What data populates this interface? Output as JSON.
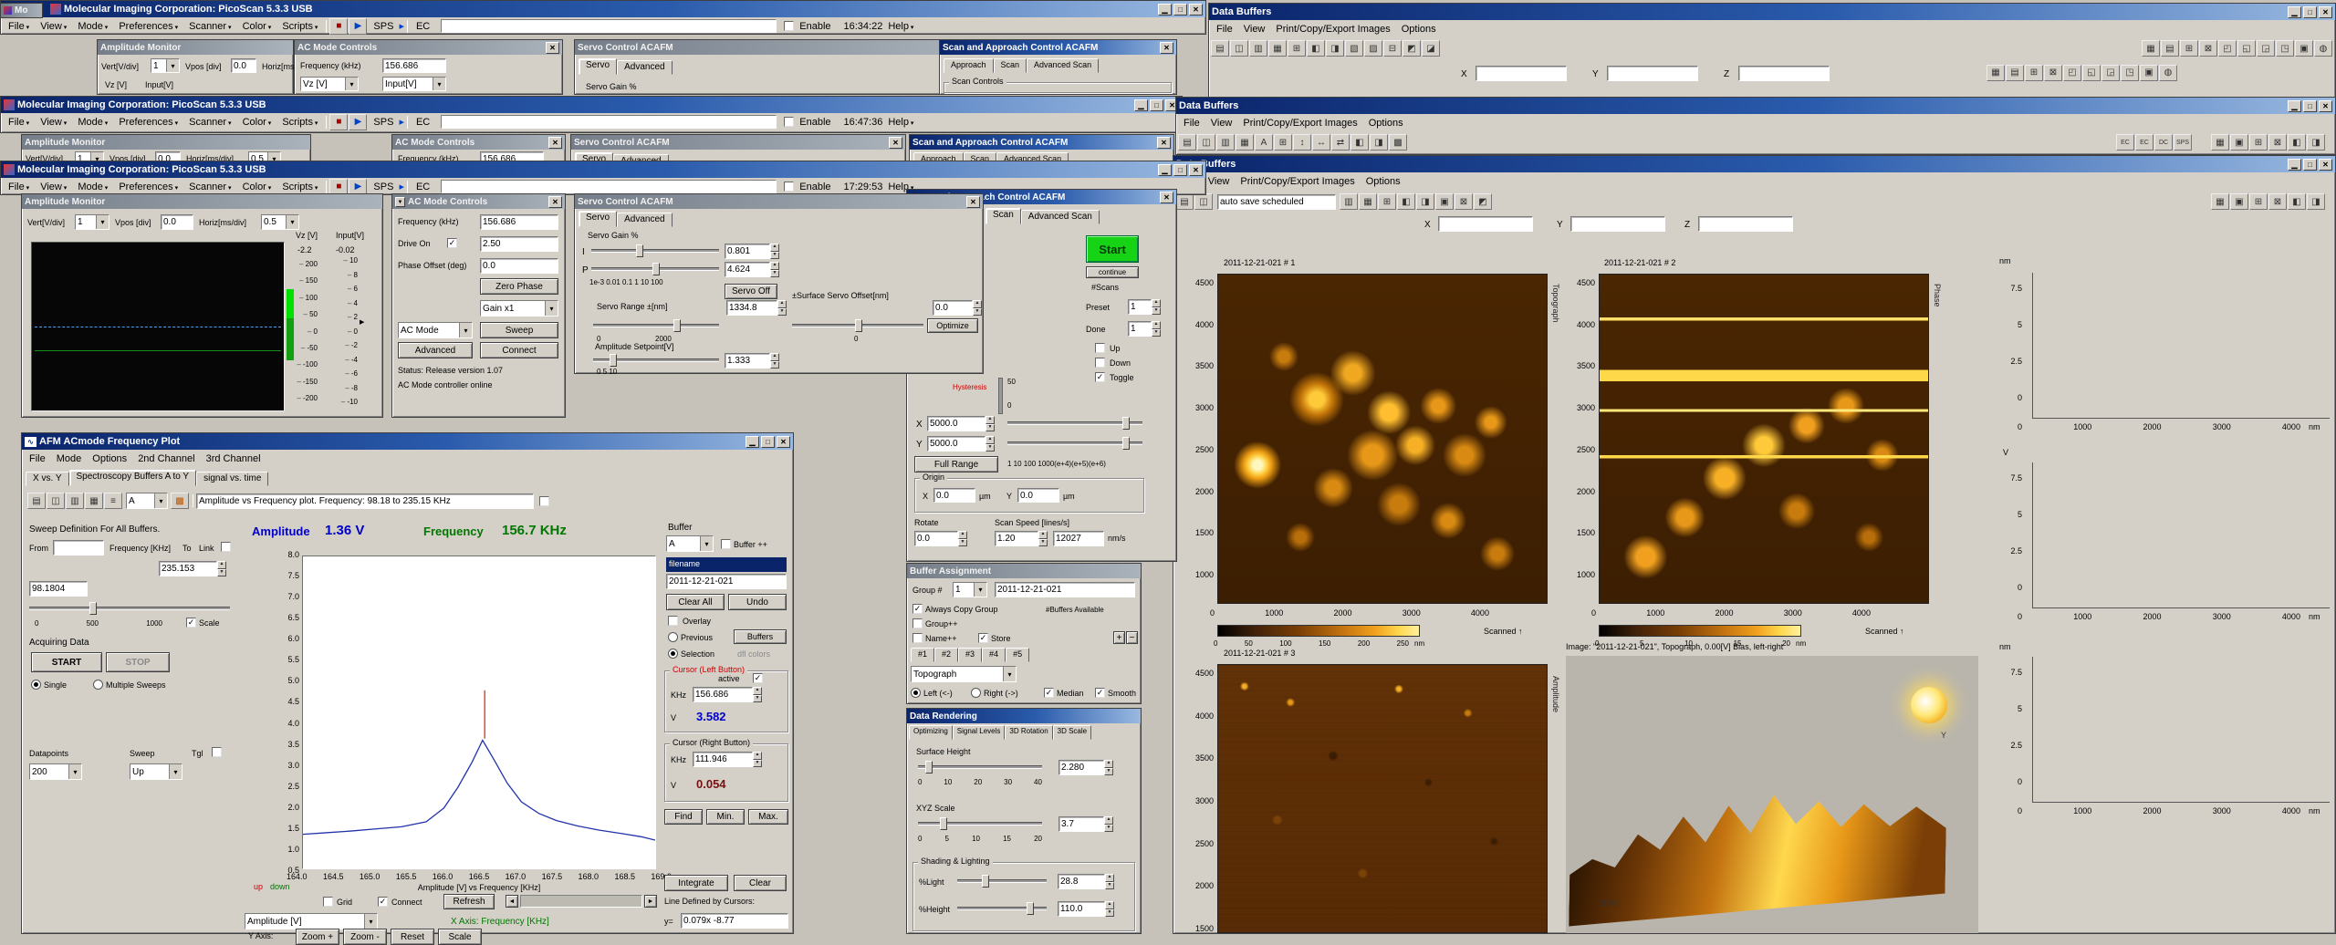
{
  "desktop": {
    "fragment_title": "Mo"
  },
  "pico": {
    "title": "Molecular Imaging Corporation: PicoScan 5.3.3  USB",
    "menu": [
      "File",
      "View",
      "Mode",
      "Preferences",
      "Scanner",
      "Color",
      "Scripts"
    ],
    "sps": "SPS",
    "ec": "EC",
    "enable_label": "Enable",
    "help": "Help",
    "times": {
      "w1": "16:34:22",
      "w2": "16:47:36",
      "w3": "17:29:53"
    }
  },
  "amp": {
    "title": "Amplitude  Monitor",
    "vert_label": "Vert[V/div]",
    "vert_value": "1",
    "vpos_label": "Vpos [div]",
    "vpos_value": "0.0",
    "horiz_label": "Horiz[ms/div]",
    "horiz_value": "0.5",
    "ch1": "Vz [V]",
    "ch1_value": "-2.2",
    "ch2": "Input[V]",
    "ch2_value": "-0.02",
    "scale_left": [
      "200",
      "150",
      "100",
      "50",
      "0",
      "-50",
      "-100",
      "-150",
      "-200"
    ],
    "scale_right": [
      "10",
      "8",
      "6",
      "4",
      "2",
      "0",
      "-2",
      "-4",
      "-6",
      "-8",
      "-10"
    ]
  },
  "acm": {
    "title": "AC Mode Controls",
    "frequency_label": "Frequency (kHz)",
    "frequency_value": "156.686",
    "drive_label": "Drive On",
    "drive_value": "2.50",
    "phase_label": "Phase Offset (deg)",
    "phase_value": "0.0",
    "zero_phase": "Zero Phase",
    "gain": "Gain x1",
    "mode": "AC Mode",
    "sweep": "Sweep",
    "advanced": "Advanced",
    "connect": "Connect",
    "status1": "Status:   Release version 1.07",
    "status2": "AC Mode controller online",
    "w1_ch1": "Vz [V]",
    "w1_ch2": "Input[V]"
  },
  "servo": {
    "title": "Servo Control ACAFM",
    "tab_servo": "Servo",
    "tab_advanced": "Advanced",
    "gain_group": "Servo Gain %",
    "i": "I",
    "p": "P",
    "i_value": "0.801",
    "p_value": "4.624",
    "log_scale": "1e-3  0.01    0.1      1       10     100",
    "servo_off": "Servo Off",
    "offset_label": "±Surface   Servo Offset[nm]",
    "offset_value": "0.0",
    "optimize": "Optimize",
    "offset_tick": "0",
    "range_label": "Servo Range ±[nm]",
    "range_value": "1334.8",
    "range_min": "0",
    "range_max": "2000",
    "setpoint_label": "Amplitude Setpoint[V]",
    "setpoint_value": "1.333",
    "setpoint_scale": "0            5             10"
  },
  "scan": {
    "title": "Scan and Approach Control ACAFM",
    "w1_tabs": [
      "Approach",
      "Scan",
      "Advanced Scan"
    ],
    "tab_scan": "Scan",
    "tab_adv": "Advanced Scan",
    "scan_controls": "Scan Controls",
    "start": "Start",
    "cont": "continue",
    "nscans": "#Scans",
    "preset": "Preset",
    "preset_value": "1",
    "done": "Done",
    "done_value": "1",
    "up": "Up",
    "down": "Down",
    "toggle": "Toggle",
    "hyst": "Hysteresis",
    "g50": "50",
    "g0": "0",
    "x": "X",
    "x_value": "5000.0",
    "y": "Y",
    "y_value": "5000.0",
    "full_range": "Full Range",
    "log_scale": "1     10    100   1000(e+4)(e+5)(e+6)",
    "origin": "Origin",
    "ox": "X",
    "ox_value": "0.0",
    "um": "µm",
    "oy": "Y",
    "oy_value": "0.0",
    "rotate": "Rotate",
    "rotate_value": "0.0",
    "speed_label": "Scan Speed [lines/s]",
    "speed": "1.20",
    "speed_nm": "12027",
    "nms": "nm/s"
  },
  "ba": {
    "title": "Buffer Assignment",
    "group": "Group #",
    "group_value": "1",
    "name": "2011-12-21-021",
    "always": "Always Copy Group",
    "avail": "#Buffers Available",
    "grouppp": "Group++",
    "namepp": "Name++",
    "store": "Store",
    "plus": "+",
    "minus": "−",
    "tabs": [
      "#1",
      "#2",
      "#3",
      "#4",
      "#5"
    ],
    "signal": "Topograph",
    "left": "Left (<-)",
    "right": "Right (->)",
    "median": "Median",
    "smooth": "Smooth"
  },
  "dr": {
    "title": "Data Rendering",
    "tabs": [
      "Optimizing",
      "Signal Levels",
      "3D Rotation",
      "3D Scale"
    ],
    "surface": "Surface Height",
    "surface_value": "2.280",
    "surface_ticks": [
      "0",
      "10",
      "20",
      "30",
      "40"
    ],
    "xyz": "XYZ Scale",
    "xyz_value": "3.7",
    "xyz_ticks": [
      "0",
      "5",
      "10",
      "15",
      "20"
    ],
    "shading": "Shading & Lighting",
    "light": "%Light",
    "light_value": "28.8",
    "height": "%Height",
    "height_value": "110.0"
  },
  "fp": {
    "title": "AFM ACmode Frequency Plot",
    "menu": [
      "File",
      "Mode",
      "Options",
      "2nd Channel",
      "3rd Channel"
    ],
    "tab1": "X vs. Y",
    "tab2": "Spectroscopy Buffers A to Y",
    "tab3": "signal vs. time",
    "combo_a": "A",
    "desc": "Amplitude vs Frequency plot. Frequency: 98.18 to 235.15 KHz",
    "sweep_group": "Sweep Definition For All Buffers.",
    "from": "From",
    "fkhz": "Frequency [KHz]",
    "to": "To",
    "link": "Link",
    "to_value": "235.153",
    "from_value": "98.1804",
    "range_ticks": [
      "0",
      "500",
      "1000"
    ],
    "scale": "Scale",
    "acq": "Acquiring Data",
    "start": "START",
    "stop": "STOP",
    "single": "Single",
    "multiple": "Multiple Sweeps",
    "datapoints": "Datapoints",
    "dp_value": "200",
    "sweep": "Sweep",
    "sweep_value": "Up",
    "tgl": "Tgl",
    "amp": "Amplitude",
    "amp_value": "1.36 V",
    "freq": "Frequency",
    "freq_value": "156.7 KHz",
    "caption": "Amplitude [V] vs Frequency [KHz]",
    "up": "up",
    "down": "down",
    "grid": "Grid",
    "connect": "Connect",
    "refresh": "Refresh",
    "ycombo": "Amplitude [V]",
    "xaxis": "X Axis: Frequency [KHz]",
    "yaxis_label": "Y Axis:",
    "zoom_in": "Zoom +",
    "zoom_out": "Zoom -",
    "reset": "Reset",
    "scale_btn": "Scale",
    "buf": {
      "label": "Buffer",
      "combo": "A",
      "bufpp": "Buffer ++",
      "filename": "filename",
      "name_value": "2011-12-21-021",
      "clear_all": "Clear All",
      "undo": "Undo",
      "overlay": "Overlay",
      "previous": "Previous",
      "buffers": "Buffers",
      "selection": "Selection",
      "dfl": "dfl colors",
      "cl_title": "Cursor (Left Button)",
      "active": "active",
      "khz": "KHz",
      "v": "V",
      "cl_khz": "156.686",
      "cl_v": "3.582",
      "cr_title": "Cursor (Right Button)",
      "cr_khz": "111.946",
      "cr_v": "0.054",
      "find": "Find",
      "min": "Min.",
      "max": "Max.",
      "integrate": "Integrate",
      "clear": "Clear",
      "line_label": "Line Defined by Cursors:",
      "yeq": "y=",
      "line_value": "0.079x -8.77"
    }
  },
  "chart_data": {
    "type": "line",
    "title": "Amplitude [V] vs Frequency [KHz]",
    "xlabel": "Frequency [KHz]",
    "ylabel": "Amplitude [V]",
    "xlim": [
      164.0,
      169.0
    ],
    "ylim": [
      0.5,
      8.0
    ],
    "grid": false,
    "legend_position": "none",
    "x_ticks": [
      "164.0",
      "164.5",
      "165.0",
      "165.5",
      "166.0",
      "166.5",
      "167.0",
      "167.5",
      "168.0",
      "168.5",
      "169.0"
    ],
    "y_ticks": [
      "8.0",
      "7.5",
      "7.0",
      "6.5",
      "6.0",
      "5.5",
      "5.0",
      "4.5",
      "4.0",
      "3.5",
      "3.0",
      "2.5",
      "2.0",
      "1.5",
      "1.0",
      "0.5"
    ],
    "series": [
      {
        "name": "Amplitude [V]",
        "color": "#2233aa",
        "points": [
          [
            164.0,
            1.32
          ],
          [
            164.35,
            1.36
          ],
          [
            164.7,
            1.4
          ],
          [
            165.05,
            1.45
          ],
          [
            165.4,
            1.5
          ],
          [
            165.75,
            1.62
          ],
          [
            166.0,
            1.95
          ],
          [
            166.2,
            2.45
          ],
          [
            166.4,
            3.05
          ],
          [
            166.55,
            3.58
          ],
          [
            166.7,
            3.15
          ],
          [
            166.9,
            2.55
          ],
          [
            167.1,
            2.1
          ],
          [
            167.35,
            1.82
          ],
          [
            167.6,
            1.65
          ],
          [
            167.9,
            1.52
          ],
          [
            168.2,
            1.42
          ],
          [
            168.55,
            1.33
          ],
          [
            168.8,
            1.26
          ],
          [
            169.0,
            1.18
          ]
        ]
      }
    ],
    "cursor_line": {
      "x": 166.58,
      "y_from": 3.62,
      "y_to": 4.78,
      "color": "#cc2200"
    },
    "readouts": {
      "amplitude": "1.36 V",
      "frequency": "156.7 KHz",
      "cursor_left_khz": "156.686",
      "cursor_left_v": "3.582",
      "cursor_right_khz": "111.946",
      "cursor_right_v": "0.054"
    }
  },
  "db": {
    "title": "Data Buffers",
    "menu": [
      "File",
      "View",
      "Print/Copy/Export Images",
      "Options"
    ],
    "auto_save": "auto save scheduled",
    "x": "X",
    "y": "Y",
    "z": "Z",
    "tool_texts": [
      "EC",
      "EC",
      "DC",
      "SPS"
    ],
    "img1": {
      "title": "2011-12-21-021 # 1",
      "yticks": [
        "4500",
        "4000",
        "3500",
        "3000",
        "2500",
        "2000",
        "1500",
        "1000"
      ],
      "xticks": [
        "0",
        "1000",
        "2000",
        "3000",
        "4000"
      ],
      "cticks": [
        "0",
        "50",
        "100",
        "150",
        "200",
        "250"
      ],
      "unit": "nm",
      "scanned": "Scanned ↑",
      "side": "Topograph"
    },
    "img2": {
      "title": "2011-12-21-021 # 2",
      "yticks": [
        "4500",
        "4000",
        "3500",
        "3000",
        "2500",
        "2000",
        "1500",
        "1000"
      ],
      "xticks": [
        "0",
        "1000",
        "2000",
        "3000",
        "4000"
      ],
      "cticks": [
        "0",
        "5",
        "10",
        "15",
        "20"
      ],
      "unit": "nm",
      "scanned": "Scanned ↑",
      "side": "Phase"
    },
    "img3": {
      "title": "2011-12-21-021 # 3",
      "yticks": [
        "4500",
        "4000",
        "3500",
        "3000",
        "2500",
        "2000",
        "1500"
      ],
      "side": "Amplitude"
    },
    "img4": {
      "caption": "Image: \"2011-12-21-021\", Topograph, 0.00[V] Bias, left-right",
      "corner": "2000",
      "yaxis": "Y"
    },
    "profiles": [
      {
        "unit": "nm",
        "yticks": [
          "7.5",
          "5",
          "2.5",
          "0"
        ],
        "xticks": [
          "0",
          "1000",
          "2000",
          "3000",
          "4000"
        ],
        "xunit": "nm"
      },
      {
        "unit": "V",
        "yticks": [
          "7.5",
          "5",
          "2.5",
          "0"
        ],
        "xticks": [
          "0",
          "1000",
          "2000",
          "3000",
          "4000"
        ],
        "xunit": "nm"
      },
      {
        "unit": "nm",
        "yticks": [
          "7.5",
          "5",
          "2.5",
          "0"
        ],
        "xticks": [
          "0",
          "1000",
          "2000",
          "3000",
          "4000"
        ],
        "xunit": "nm"
      }
    ]
  },
  "icons": {
    "script_stop": "■",
    "script_run": "▶",
    "sps_arrow": "▸",
    "tb_back": [
      "▤",
      "◫",
      "▥",
      "▦",
      "⊞",
      "◧",
      "◨",
      "▧",
      "▨",
      "⊟",
      "◩",
      "◪"
    ],
    "tb_back_r": [
      "▦",
      "▤",
      "⊞",
      "⊠",
      "◰",
      "◱",
      "◲",
      "◳",
      "▣",
      "◍"
    ],
    "tb_front": [
      "▤",
      "◫",
      "▥",
      "▦",
      "A",
      "⊞",
      "↕",
      "↔",
      "⇄",
      "◧",
      "◨",
      "▩"
    ],
    "tb_front_r": [
      "▦",
      "▣",
      "⊞",
      "⊠",
      "◧",
      "◨"
    ],
    "tb_third": [
      "▤",
      "◫"
    ],
    "tb_third_b": [
      "▥",
      "▦",
      "⊞",
      "◧",
      "◨",
      "▣",
      "⊠",
      "◩"
    ],
    "fp_tools": [
      "▤",
      "◫",
      "▥",
      "▦",
      "≡"
    ],
    "fp_palette": "▩"
  }
}
